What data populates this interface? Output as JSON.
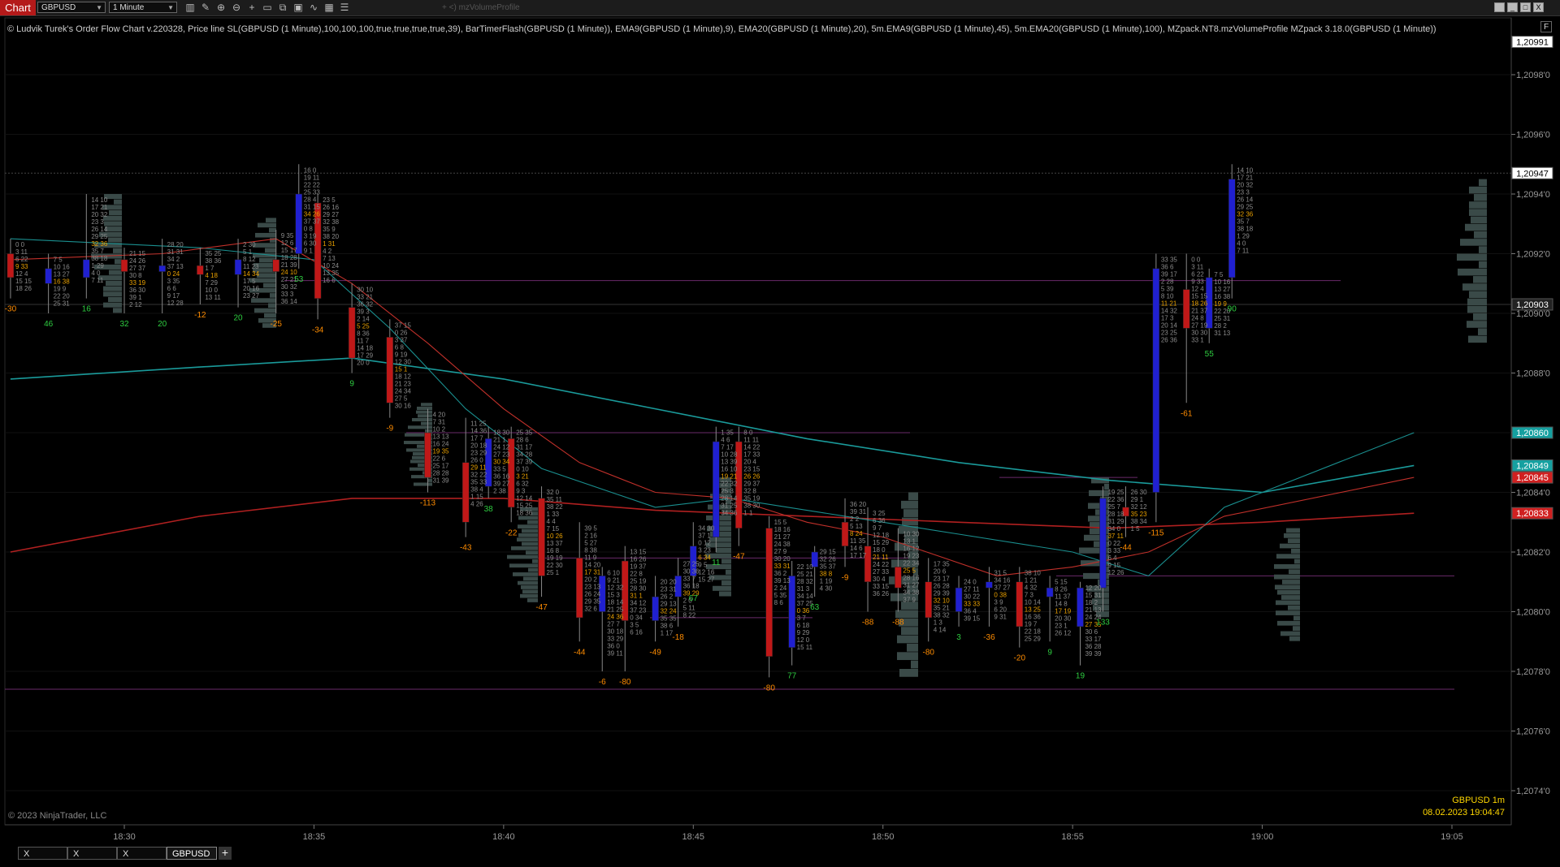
{
  "app": {
    "menu_label": "Chart"
  },
  "toolbar": {
    "instrument": "GBPUSD",
    "interval": "1 Minute",
    "indicator_label": "+ <) mzVolumeProfile",
    "icons": [
      "bar-style-icon",
      "draw-tools-icon",
      "zoom-in-icon",
      "zoom-out-icon",
      "crosshair-icon",
      "data-box-icon",
      "snapshot-icon",
      "properties-icon",
      "indicators-icon",
      "strategies-icon",
      "chart-trader-icon"
    ]
  },
  "window": {
    "minimize": "_",
    "maximize": "□",
    "close": "X"
  },
  "chart": {
    "indicator_text": "© Ludvik Turek's Order Flow Chart v.220328, Price line SL(GBPUSD (1 Minute),100,100,100,true,true,true,true,39), BarTimerFlash(GBPUSD (1 Minute)), EMA9(GBPUSD (1 Minute),9), EMA20(GBPUSD (1 Minute),20), 5m.EMA9(GBPUSD (1 Minute),45), 5m.EMA20(GBPUSD (1 Minute),100), MZpack.NT8.mzVolumeProfile MZpack 3.18.0(GBPUSD (1 Minute))",
    "copyright": "© 2023 NinjaTrader, LLC",
    "instrument_label": "GBPUSD 1m",
    "datetime_label": "08.02.2023 19:04:47",
    "f_button": "F",
    "colors": {
      "ema9": "#c0302a",
      "ema20": "#1a8f8f",
      "ema5m9": "#b02020",
      "ema5m20": "#1a9a9a",
      "bull": "#2020d0",
      "bear": "#c01818",
      "pos": "#2ecc40",
      "neg": "#ff8c00",
      "profile": "#3a4a48",
      "poc": "#b040d0"
    }
  },
  "chart_data": {
    "type": "candlestick",
    "title": "",
    "ylim": [
      1.20765,
      1.20995
    ],
    "y_ticks": [
      "1,2098'0",
      "1,2096'0",
      "1,2094'0",
      "1,2092'0",
      "1,2090'0",
      "1,2088'0",
      "1,2086'0",
      "1,2084'0",
      "1,2082'0",
      "1,2080'0",
      "1,2078'0",
      "1,2076'0",
      "1,2074'0"
    ],
    "y_tick_values": [
      1.2098,
      1.2096,
      1.2094,
      1.2092,
      1.209,
      1.2088,
      1.2086,
      1.2084,
      1.2082,
      1.208,
      1.2078,
      1.2076,
      1.2074
    ],
    "x_ticks": [
      "18:30",
      "18:35",
      "18:40",
      "18:45",
      "18:50",
      "18:55",
      "19:00",
      "19:05"
    ],
    "x_tick_minutes": [
      1110,
      1115,
      1120,
      1125,
      1130,
      1135,
      1140,
      1145
    ],
    "price_tags": [
      {
        "label": "1,20991",
        "value": 1.20991,
        "color": "#ffffff",
        "text": "#000000"
      },
      {
        "label": "1,20947",
        "value": 1.20947,
        "color": "#ffffff",
        "text": "#000000"
      },
      {
        "label": "1,20903",
        "value": 1.20903,
        "color": "#222222",
        "text": "#ffffff"
      },
      {
        "label": "1,20860",
        "value": 1.2086,
        "color": "#15a0a0",
        "text": "#ffffff"
      },
      {
        "label": "1,20849",
        "value": 1.20849,
        "color": "#15a0a0",
        "text": "#ffffff"
      },
      {
        "label": "1,20845",
        "value": 1.20845,
        "color": "#d02020",
        "text": "#ffffff"
      },
      {
        "label": "1,20833",
        "value": 1.20833,
        "color": "#d02020",
        "text": "#ffffff"
      }
    ],
    "candles": [
      {
        "t": 1107.0,
        "o": 1.2092,
        "h": 1.20925,
        "c": 1.20912,
        "l": 1.20905,
        "delta": "-30"
      },
      {
        "t": 1108.0,
        "o": 1.2091,
        "h": 1.2092,
        "c": 1.20915,
        "l": 1.209,
        "delta": "46"
      },
      {
        "t": 1109.0,
        "o": 1.20912,
        "h": 1.2094,
        "c": 1.20918,
        "l": 1.20905,
        "delta": "16"
      },
      {
        "t": 1110.0,
        "o": 1.20918,
        "h": 1.20922,
        "c": 1.20914,
        "l": 1.209,
        "delta": "32"
      },
      {
        "t": 1111.0,
        "o": 1.20914,
        "h": 1.20925,
        "c": 1.20916,
        "l": 1.209,
        "delta": "20"
      },
      {
        "t": 1112.0,
        "o": 1.20916,
        "h": 1.20922,
        "c": 1.20913,
        "l": 1.20903,
        "delta": "-12"
      },
      {
        "t": 1113.0,
        "o": 1.20913,
        "h": 1.20925,
        "c": 1.20918,
        "l": 1.20902,
        "delta": "20"
      },
      {
        "t": 1114.0,
        "o": 1.20918,
        "h": 1.20928,
        "c": 1.20914,
        "l": 1.209,
        "delta": "-25"
      },
      {
        "t": 1114.6,
        "o": 1.2092,
        "h": 1.2095,
        "c": 1.2094,
        "l": 1.20915,
        "delta": "53"
      },
      {
        "t": 1115.1,
        "o": 1.20937,
        "h": 1.2094,
        "c": 1.20905,
        "l": 1.20898,
        "delta": "-34"
      },
      {
        "t": 1116.0,
        "o": 1.20902,
        "h": 1.2091,
        "c": 1.20885,
        "l": 1.2088,
        "delta": "9"
      },
      {
        "t": 1117.0,
        "o": 1.20892,
        "h": 1.20898,
        "c": 1.2087,
        "l": 1.20865,
        "delta": "-9"
      },
      {
        "t": 1118.0,
        "o": 1.2086,
        "h": 1.20868,
        "c": 1.20845,
        "l": 1.2084,
        "delta": "-113"
      },
      {
        "t": 1119.0,
        "o": 1.2085,
        "h": 1.20865,
        "c": 1.2083,
        "l": 1.20825,
        "delta": "-43"
      },
      {
        "t": 1119.6,
        "o": 1.20842,
        "h": 1.20862,
        "c": 1.20858,
        "l": 1.20838,
        "delta": "38"
      },
      {
        "t": 1120.2,
        "o": 1.20858,
        "h": 1.20862,
        "c": 1.20835,
        "l": 1.2083,
        "delta": "-22"
      },
      {
        "t": 1121.0,
        "o": 1.20838,
        "h": 1.20842,
        "c": 1.20812,
        "l": 1.20805,
        "delta": "-47"
      },
      {
        "t": 1122.0,
        "o": 1.20818,
        "h": 1.2083,
        "c": 1.20798,
        "l": 1.2079,
        "delta": "-44"
      },
      {
        "t": 1122.6,
        "o": 1.208,
        "h": 1.20815,
        "c": 1.20812,
        "l": 1.2078,
        "delta": "-6"
      },
      {
        "t": 1123.2,
        "o": 1.20817,
        "h": 1.20822,
        "c": 1.20797,
        "l": 1.2078,
        "delta": "-80"
      },
      {
        "t": 1124.0,
        "o": 1.20797,
        "h": 1.20812,
        "c": 1.20805,
        "l": 1.2079,
        "delta": "-49"
      },
      {
        "t": 1124.6,
        "o": 1.20805,
        "h": 1.20818,
        "c": 1.20812,
        "l": 1.20795,
        "delta": "-18"
      },
      {
        "t": 1125.0,
        "o": 1.20812,
        "h": 1.2083,
        "c": 1.20822,
        "l": 1.20808,
        "delta": "67"
      },
      {
        "t": 1125.6,
        "o": 1.20825,
        "h": 1.20862,
        "c": 1.20857,
        "l": 1.2082,
        "delta": "11"
      },
      {
        "t": 1126.2,
        "o": 1.20857,
        "h": 1.20862,
        "c": 1.20828,
        "l": 1.20822,
        "delta": "-47"
      },
      {
        "t": 1127.0,
        "o": 1.20828,
        "h": 1.20832,
        "c": 1.20785,
        "l": 1.20778,
        "delta": "-80"
      },
      {
        "t": 1127.6,
        "o": 1.20788,
        "h": 1.20817,
        "c": 1.20812,
        "l": 1.20782,
        "delta": "77"
      },
      {
        "t": 1128.2,
        "o": 1.20815,
        "h": 1.20822,
        "c": 1.2082,
        "l": 1.20805,
        "delta": "63"
      },
      {
        "t": 1129.0,
        "o": 1.2083,
        "h": 1.20838,
        "c": 1.20822,
        "l": 1.20815,
        "delta": "-9"
      },
      {
        "t": 1129.6,
        "o": 1.20822,
        "h": 1.20835,
        "c": 1.2081,
        "l": 1.208,
        "delta": "-88"
      },
      {
        "t": 1130.4,
        "o": 1.20815,
        "h": 1.20828,
        "c": 1.20808,
        "l": 1.208,
        "delta": "-88"
      },
      {
        "t": 1131.2,
        "o": 1.2081,
        "h": 1.20818,
        "c": 1.20798,
        "l": 1.2079,
        "delta": "-80"
      },
      {
        "t": 1132.0,
        "o": 1.208,
        "h": 1.20812,
        "c": 1.20808,
        "l": 1.20795,
        "delta": "3"
      },
      {
        "t": 1132.8,
        "o": 1.20808,
        "h": 1.20815,
        "c": 1.2081,
        "l": 1.20795,
        "delta": "-36"
      },
      {
        "t": 1133.6,
        "o": 1.2081,
        "h": 1.20815,
        "c": 1.20795,
        "l": 1.20788,
        "delta": "-20"
      },
      {
        "t": 1134.4,
        "o": 1.20805,
        "h": 1.20812,
        "c": 1.20808,
        "l": 1.2079,
        "delta": "9"
      },
      {
        "t": 1135.2,
        "o": 1.20795,
        "h": 1.2081,
        "c": 1.20808,
        "l": 1.20782,
        "delta": "19"
      },
      {
        "t": 1135.8,
        "o": 1.20808,
        "h": 1.20842,
        "c": 1.20838,
        "l": 1.208,
        "delta": "133"
      },
      {
        "t": 1136.4,
        "o": 1.20835,
        "h": 1.20842,
        "c": 1.20832,
        "l": 1.20825,
        "delta": "-44"
      },
      {
        "t": 1137.2,
        "o": 1.2084,
        "h": 1.2092,
        "c": 1.20915,
        "l": 1.2083,
        "delta": "-115"
      },
      {
        "t": 1138.0,
        "o": 1.20908,
        "h": 1.2092,
        "c": 1.20895,
        "l": 1.2087,
        "delta": "-61"
      },
      {
        "t": 1138.6,
        "o": 1.20895,
        "h": 1.20915,
        "c": 1.20912,
        "l": 1.2089,
        "delta": "55"
      },
      {
        "t": 1139.2,
        "o": 1.20912,
        "h": 1.2095,
        "c": 1.20945,
        "l": 1.20905,
        "delta": "90"
      }
    ]
  }
}
